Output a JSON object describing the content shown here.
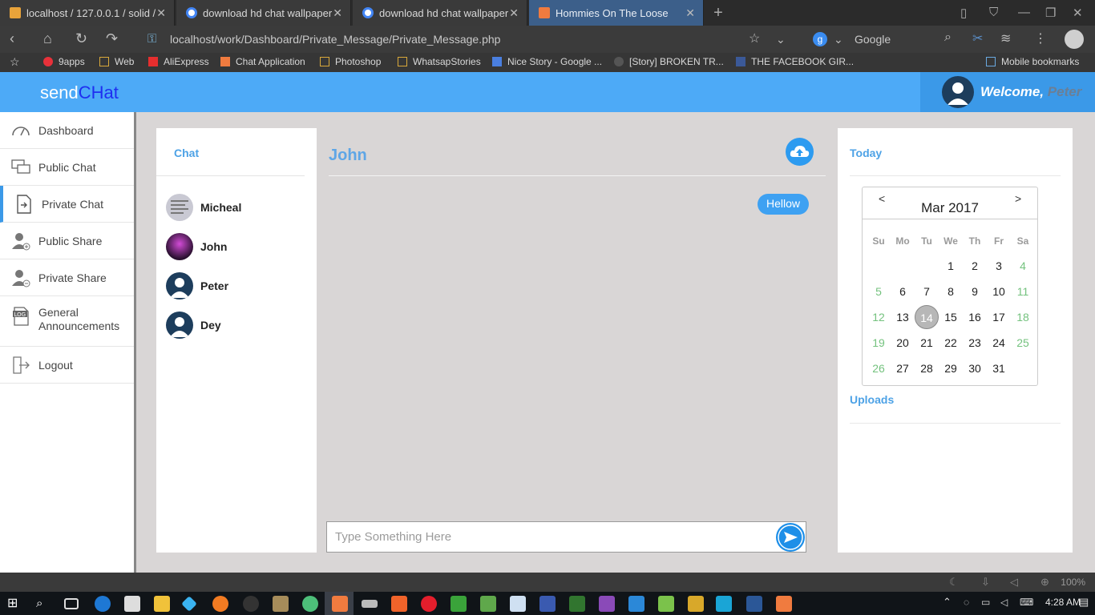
{
  "browser": {
    "tabs": [
      {
        "label": "localhost / 127.0.0.1 / solid /",
        "icon": "phpmyadmin-icon",
        "active": false
      },
      {
        "label": "download hd chat wallpaper",
        "icon": "google-icon",
        "active": false
      },
      {
        "label": "download hd chat wallpaper",
        "icon": "google-icon",
        "active": false
      },
      {
        "label": "Hommies On The Loose",
        "icon": "xampp-icon",
        "active": true
      }
    ],
    "url": "localhost/work/Dashboard/Private_Message/Private_Message.php",
    "search_engine": "Google",
    "bookmarks": [
      {
        "label": "9apps",
        "icon": "9apps-icon"
      },
      {
        "label": "Web",
        "icon": "folder-icon"
      },
      {
        "label": "AliExpress",
        "icon": "aliexpress-icon"
      },
      {
        "label": "Chat Application",
        "icon": "xampp-icon"
      },
      {
        "label": "Photoshop",
        "icon": "folder-icon"
      },
      {
        "label": "WhatsapStories",
        "icon": "folder-icon"
      },
      {
        "label": "Nice Story - Google ...",
        "icon": "docs-icon"
      },
      {
        "label": "[Story] BROKEN TR...",
        "icon": "story-icon"
      },
      {
        "label": "THE FACEBOOK GIR...",
        "icon": "facebook-icon"
      }
    ],
    "mobile_bookmarks": "Mobile bookmarks",
    "zoom": "100%"
  },
  "app": {
    "brand_part1": "send",
    "brand_part2": "CHat",
    "welcome_prefix": "Welcome,",
    "welcome_name": "Peter",
    "accent": "#4daaf7"
  },
  "sidebar": {
    "items": [
      {
        "label": "Dashboard",
        "icon": "dashboard-gauge-icon"
      },
      {
        "label": "Public Chat",
        "icon": "chat-bubbles-icon"
      },
      {
        "label": "Private Chat",
        "icon": "private-chat-icon"
      },
      {
        "label": "Public Share",
        "icon": "user-plus-icon"
      },
      {
        "label": "Private Share",
        "icon": "user-minus-icon"
      },
      {
        "label": "General Announcements",
        "icon": "log-document-icon"
      },
      {
        "label": "Logout",
        "icon": "logout-door-icon"
      }
    ]
  },
  "chatlist": {
    "title": "Chat",
    "contacts": [
      {
        "name": "Micheal"
      },
      {
        "name": "John"
      },
      {
        "name": "Peter"
      },
      {
        "name": "Dey"
      }
    ]
  },
  "conversation": {
    "title": "John",
    "messages": [
      {
        "text": "Hellow",
        "side": "right"
      }
    ],
    "input_placeholder": "Type Something Here"
  },
  "rightpanel": {
    "today_title": "Today",
    "uploads_title": "Uploads",
    "calendar": {
      "month_label": "Mar 2017",
      "prev": "<",
      "next": ">",
      "weekdays": [
        "Su",
        "Mo",
        "Tu",
        "We",
        "Th",
        "Fr",
        "Sa"
      ],
      "first_weekday_index": 3,
      "days_in_month": 31,
      "today": 14
    }
  },
  "taskbar": {
    "time": "4:28 AM"
  }
}
